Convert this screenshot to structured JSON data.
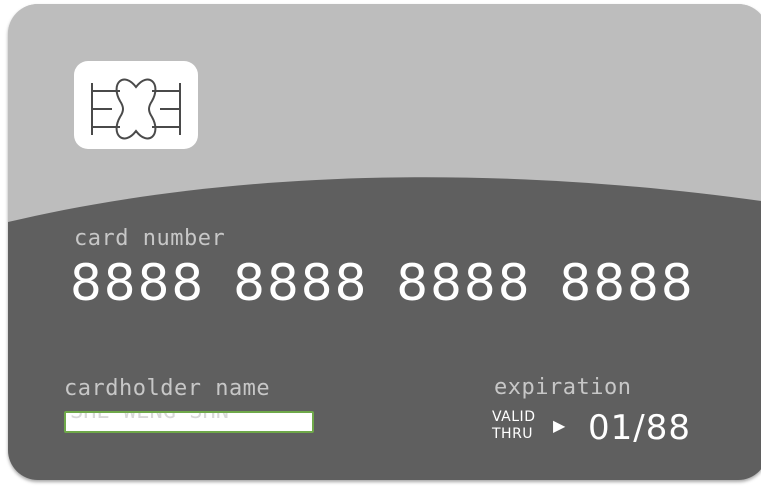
{
  "card": {
    "colors": {
      "top": "#bdbdbd",
      "bottom": "#5f5f5f",
      "chip": "#ffffff",
      "field_border": "#6fa84a"
    },
    "chip_icon": "sim-chip-icon",
    "number_label": "card number",
    "number": "8888 8888 8888 8888",
    "holder_label": "cardholder name",
    "holder_value": "SHE WENG SHN",
    "expiration_label": "expiration",
    "valid_line1": "VALID",
    "valid_line2": "THRU",
    "arrow_icon": "play-triangle-icon",
    "expiration_value": "01/88"
  }
}
